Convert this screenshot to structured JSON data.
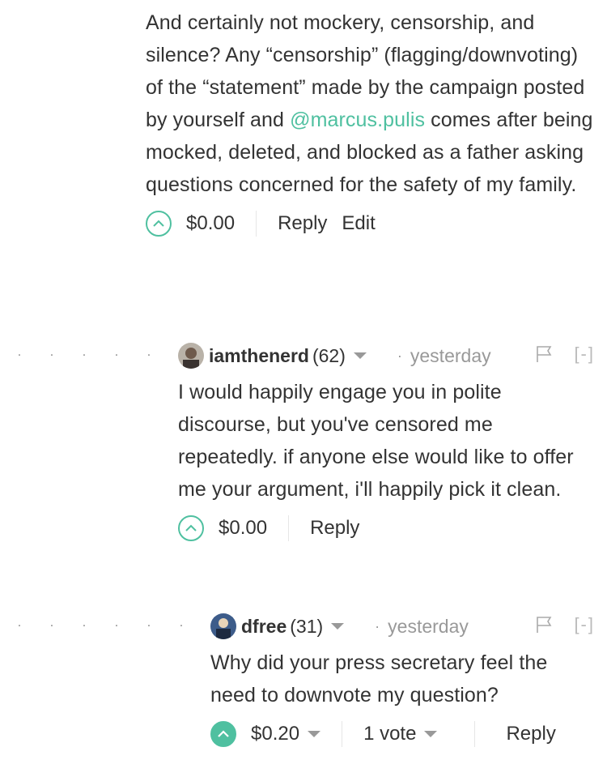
{
  "comment1": {
    "body_before": "And certainly not mockery, censorship, and silence? Any “censorship” (flagging/downvoting) of the “statement” made by the campaign posted by yourself and ",
    "mention": "@marcus.pulis",
    "body_after": " comes after being mocked, deleted, and blocked as a father asking questions concerned for the safety of my family.",
    "payout": "$0.00",
    "reply_label": "Reply",
    "edit_label": "Edit"
  },
  "comment2": {
    "author": "iamthenerd",
    "reputation": "(62)",
    "time": "yesterday",
    "collapse": "[-]",
    "body": "I would happily engage you in polite discourse, but you've censored me repeatedly. if anyone else would like to offer me your argument, i'll happily pick it clean.",
    "payout": "$0.00",
    "reply_label": "Reply"
  },
  "comment3": {
    "author": "dfree",
    "reputation": "(31)",
    "time": "yesterday",
    "collapse": "[-]",
    "body": "Why did your press secretary feel the need to downvote my question?",
    "payout": "$0.20",
    "votes": "1 vote",
    "reply_label": "Reply",
    "upvoted": true
  },
  "icons": {
    "upvote": "upvote-chevron-icon",
    "flag": "flag-icon",
    "dropdown": "caret-down-icon"
  },
  "colors": {
    "accent": "#4fc0a0",
    "muted": "#999999",
    "text": "#333333"
  }
}
